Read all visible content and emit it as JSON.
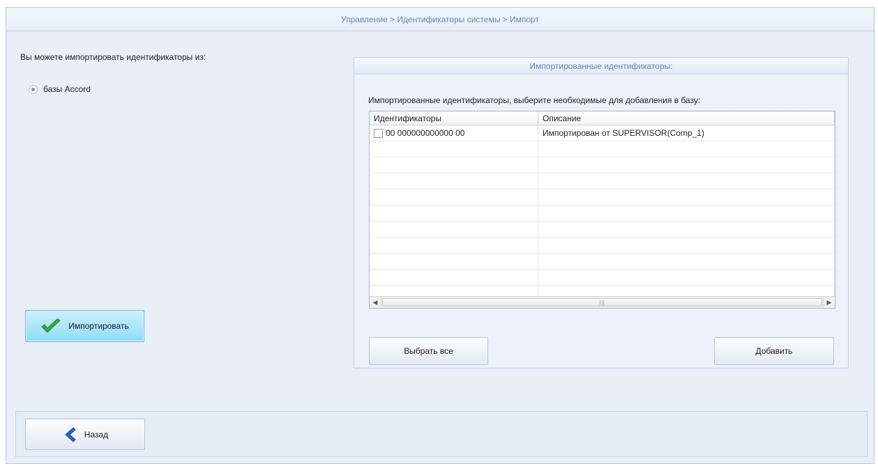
{
  "header": {
    "breadcrumb": "Управление > Идентификаторы системы > Импорт"
  },
  "left": {
    "intro_text": "Вы можете импортировать идентификаторы из:",
    "radio_label": "базы Accord",
    "radio_selected": true,
    "import_button_label": "Импортировать"
  },
  "panel": {
    "title": "Импортированные идентификаторы:",
    "subtitle": "Импортированные идентификаторы, выберите необходимые для добавления в базу:",
    "columns": [
      "Идентификаторы",
      "Описание"
    ],
    "rows": [
      {
        "id": "00 000000000000 00",
        "description": "Импортирован от SUPERVISOR(Comp_1)",
        "checked": false
      }
    ],
    "select_all_label": "Выбрать все",
    "add_label": "Добавить"
  },
  "footer": {
    "back_label": "Назад"
  },
  "colors": {
    "header_text": "#6a85b6",
    "panel_bg": "#edf2fa",
    "import_button": "#8fdcf8",
    "check_icon": "#3aa63a",
    "back_icon": "#2b62c9"
  },
  "icons": {
    "import": "checkmark-icon",
    "back": "chevron-left-icon"
  }
}
